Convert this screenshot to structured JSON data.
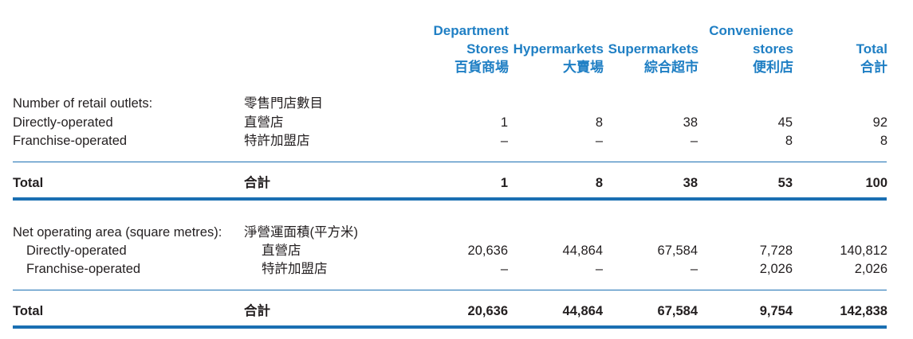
{
  "columns": [
    {
      "en_lines": [
        "Department",
        "Stores"
      ],
      "zh": "百貨商場"
    },
    {
      "en_lines": [
        "Hypermarkets"
      ],
      "zh": "大賣場"
    },
    {
      "en_lines": [
        "Supermarkets"
      ],
      "zh": "綜合超市"
    },
    {
      "en_lines": [
        "Convenience",
        "stores"
      ],
      "zh": "便利店"
    },
    {
      "en_lines": [
        "Total"
      ],
      "zh": "合計"
    }
  ],
  "outlets": {
    "heading_en": "Number of retail outlets:",
    "heading_zh": "零售門店數目",
    "rows": [
      {
        "en": "Directly-operated",
        "zh": "直營店",
        "values": [
          "1",
          "8",
          "38",
          "45",
          "92"
        ]
      },
      {
        "en": "Franchise-operated",
        "zh": "特許加盟店",
        "values": [
          "–",
          "–",
          "–",
          "8",
          "8"
        ]
      }
    ],
    "total": {
      "en": "Total",
      "zh": "合計",
      "values": [
        "1",
        "8",
        "38",
        "53",
        "100"
      ]
    }
  },
  "area": {
    "heading_en": "Net operating area (square metres):",
    "heading_zh": "淨營運面積(平方米)",
    "rows": [
      {
        "en": "Directly-operated",
        "zh": "直營店",
        "values": [
          "20,636",
          "44,864",
          "67,584",
          "7,728",
          "140,812"
        ]
      },
      {
        "en": "Franchise-operated",
        "zh": "特許加盟店",
        "values": [
          "–",
          "–",
          "–",
          "2,026",
          "2,026"
        ]
      }
    ],
    "total": {
      "en": "Total",
      "zh": "合計",
      "values": [
        "20,636",
        "44,864",
        "67,584",
        "9,754",
        "142,838"
      ]
    }
  },
  "colors": {
    "header": "#1f7fc4",
    "rule": "#1a6fb2",
    "text": "#231f20"
  }
}
